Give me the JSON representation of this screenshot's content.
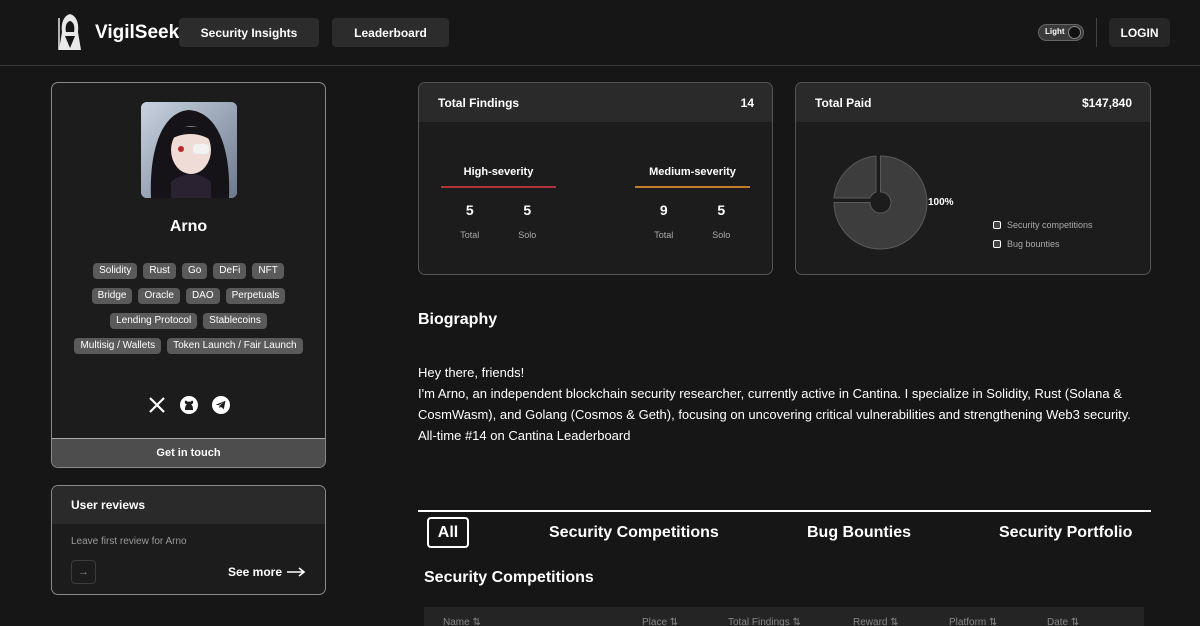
{
  "header": {
    "brand": "VigilSeek",
    "nav": [
      "Security Insights",
      "Leaderboard"
    ],
    "theme_label": "Light",
    "login_label": "LOGIN"
  },
  "profile": {
    "name": "Arno",
    "tags": [
      [
        "Solidity",
        "Rust",
        "Go",
        "DeFi",
        "NFT"
      ],
      [
        "Bridge",
        "Oracle",
        "DAO",
        "Perpetuals"
      ],
      [
        "Lending Protocol",
        "Stablecoins"
      ],
      [
        "Multisig / Wallets",
        "Token Launch / Fair Launch"
      ]
    ],
    "socials": [
      "x-icon",
      "github-icon",
      "telegram-icon"
    ],
    "contact_label": "Get in touch"
  },
  "reviews": {
    "title": "User reviews",
    "empty_text": "Leave first review for Arno",
    "see_more": "See more"
  },
  "findings": {
    "title": "Total Findings",
    "total": "14",
    "high": {
      "title": "High-severity",
      "total": "5",
      "solo": "5",
      "color": "#b0323c"
    },
    "medium": {
      "title": "Medium-severity",
      "total": "9",
      "solo": "5",
      "color": "#c27a2c"
    },
    "total_label": "Total",
    "solo_label": "Solo"
  },
  "paid": {
    "title": "Total Paid",
    "amount": "$147,840",
    "percent": "100%",
    "legend": [
      "Security competitions",
      "Bug bounties"
    ]
  },
  "biography": {
    "title": "Biography",
    "lines": [
      "Hey there, friends!",
      "I'm Arno, an independent blockchain security researcher, currently active in Cantina. I specialize in Solidity, Rust (Solana & CosmWasm), and Golang (Cosmos & Geth), focusing on uncovering critical vulnerabilities and strengthening Web3 security.",
      "All-time #14 on Cantina Leaderboard"
    ]
  },
  "tabs": [
    "All",
    "Security Competitions",
    "Bug Bounties",
    "Security Portfolio"
  ],
  "section_title": "Security Competitions",
  "table_headers": [
    "Name",
    "Place",
    "Total Findings",
    "Reward",
    "Platform",
    "Date"
  ],
  "sort_glyph": "⇅"
}
